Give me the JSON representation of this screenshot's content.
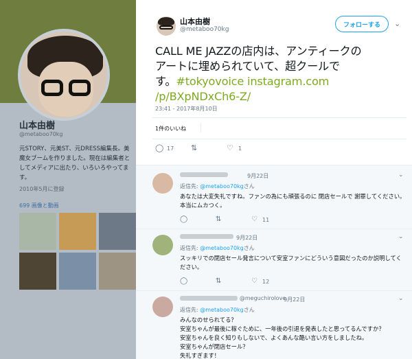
{
  "background": {
    "name": "山本由樹",
    "handle": "@metaboo70kg",
    "bio": "元STORY、元美ST、元DRESS編集長。美魔女ブームを作りました。現在は編集者としてメディアに出たり、いろいろやってます。",
    "joined": "2010年5月に登録",
    "media_label": "699 画像と動画"
  },
  "tweet": {
    "author_name": "山本由樹",
    "author_handle": "@metaboo70kg",
    "follow_label": "フォローする",
    "text_line1": "CALL ME JAZZの店内は、アンティークの",
    "text_line2": "アートに埋められていて、超クールで",
    "text_line3_prefix": "す。",
    "link_hashtag": "#tokyovoice",
    "link_instagram": "instagram.com",
    "link_path": "/p/BXpNDxCh6-Z/",
    "timestamp": "23:41 - 2017年8月10日",
    "likes_label": "1件のいいね",
    "reply_count": "17",
    "like_count": "1"
  },
  "replies": [
    {
      "date": "9月22日",
      "reply_to_prefix": "返信先: ",
      "mention": "@metaboo70kg",
      "reply_to_suffix": "さん",
      "text": "あなたは大変失礼ですね。ファンの為にも頑張るのに 閉店セールで 謝罪してください。本当にムカつく。",
      "like_count": "11"
    },
    {
      "date": "9月22日",
      "reply_to_prefix": "返信先: ",
      "mention": "@metaboo70kg",
      "reply_to_suffix": "さん",
      "text": "スッキリでの閉店セール発言について安室ファンにどういう意図だったのか説明してください。",
      "like_count": "12"
    },
    {
      "name_suffix": "@meguchirolove",
      "date": "· 9月22日",
      "reply_to_prefix": "返信先: ",
      "mention": "@metaboo70kg",
      "reply_to_suffix": "さん",
      "text_lines": [
        "みんなのせられてる？",
        "安室ちゃんが最後に稼ぐために、一年後の引退を発表したと思ってるんですか？",
        "安室ちゃんを良く知りもしないで、よくあんな酷い言い方をしましたね。",
        "安室ちゃんが閉店セール？",
        "失礼すぎます！"
      ]
    }
  ],
  "icons": {
    "reply": "reply-icon",
    "retweet": "retweet-icon",
    "like": "heart-icon",
    "more": "chevron-down-icon"
  },
  "colors": {
    "accent": "#1da1f2",
    "link": "#7eaa22"
  }
}
